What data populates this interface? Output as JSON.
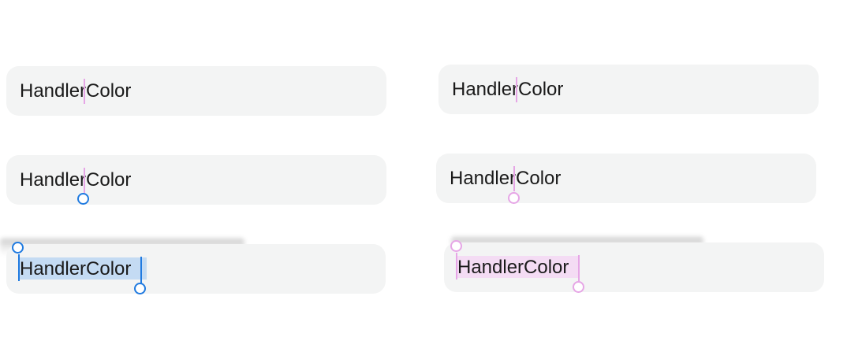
{
  "fields": [
    {
      "text": "HandlerColor",
      "state": "caret",
      "accent": "#e6a6e6"
    },
    {
      "text": "HandlerColor",
      "state": "caret",
      "accent": "#e6a6e6"
    },
    {
      "text": "HandlerColor",
      "state": "caret-handle",
      "accent": "#1f7ae0"
    },
    {
      "text": "HandlerColor",
      "state": "caret-handle",
      "accent": "#e6a6e6"
    },
    {
      "text": "HandlerColor",
      "state": "selection",
      "accent": "#1f7ae0"
    },
    {
      "text": "HandlerColor",
      "state": "selection",
      "accent": "#e6a6e6"
    }
  ],
  "colors": {
    "field_bg": "#f3f4f4",
    "blue_handle": "#1f7ae0",
    "pink_handle": "#e6a6e6",
    "blue_selection": "#c4dbf3",
    "pink_selection": "#f4dcf4"
  }
}
